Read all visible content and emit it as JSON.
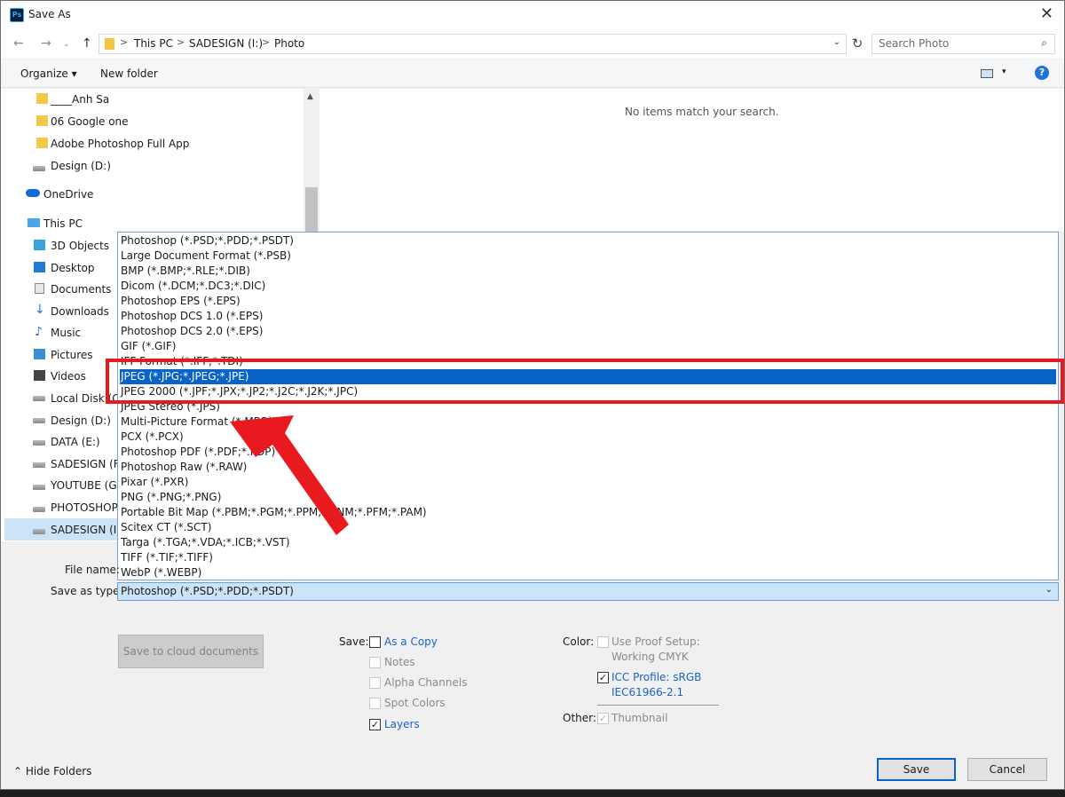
{
  "window": {
    "title": "Save As",
    "app_icon": "Ps"
  },
  "address": {
    "crumbs": [
      "This PC",
      "SADESIGN (I:)",
      "Photo"
    ],
    "search_placeholder": "Search Photo"
  },
  "toolbar": {
    "organize": "Organize",
    "new_folder": "New folder",
    "help": "?"
  },
  "content": {
    "empty_message": "No items match your search."
  },
  "nav": {
    "items": [
      "____Anh Sa",
      "06 Google one",
      "Adobe Photoshop Full App",
      "Design (D:)",
      "OneDrive",
      "This PC",
      "3D Objects",
      "Desktop",
      "Documents",
      "Downloads",
      "Music",
      "Pictures",
      "Videos",
      "Local Disk (C:)",
      "Design (D:)",
      "DATA  (E:)",
      "SADESIGN (F:)",
      "YOUTUBE (G:)",
      "PHOTOSHOP",
      "SADESIGN (I:)"
    ]
  },
  "filetypes": {
    "options": [
      "Photoshop (*.PSD;*.PDD;*.PSDT)",
      "Large Document Format (*.PSB)",
      "BMP (*.BMP;*.RLE;*.DIB)",
      "Dicom (*.DCM;*.DC3;*.DIC)",
      "Photoshop EPS (*.EPS)",
      "Photoshop DCS 1.0 (*.EPS)",
      "Photoshop DCS 2.0 (*.EPS)",
      "GIF (*.GIF)",
      "IFF Format (*.IFF;*.TDI)",
      "JPEG (*.JPG;*.JPEG;*.JPE)",
      "JPEG 2000 (*.JPF;*.JPX;*.JP2;*.J2C;*.J2K;*.JPC)",
      "JPEG Stereo (*.JPS)",
      "Multi-Picture Format (*.MPO)",
      "PCX (*.PCX)",
      "Photoshop PDF (*.PDF;*.PDP)",
      "Photoshop Raw (*.RAW)",
      "Pixar (*.PXR)",
      "PNG (*.PNG;*.PNG)",
      "Portable Bit Map (*.PBM;*.PGM;*.PPM;*.PNM;*.PFM;*.PAM)",
      "Scitex CT (*.SCT)",
      "Targa (*.TGA;*.VDA;*.ICB;*.VST)",
      "TIFF (*.TIF;*.TIFF)",
      "WebP (*.WEBP)"
    ],
    "selected_index": 9
  },
  "form": {
    "file_name_label": "File name:",
    "save_type_label": "Save as type:",
    "save_type_value": "Photoshop (*.PSD;*.PDD;*.PSDT)"
  },
  "options": {
    "cloud_button": "Save to cloud documents",
    "save_label": "Save:",
    "as_copy": "As a Copy",
    "notes": "Notes",
    "alpha": "Alpha Channels",
    "spot": "Spot Colors",
    "layers": "Layers",
    "color_label": "Color:",
    "proof_line1": "Use Proof Setup:",
    "proof_line2": "Working CMYK",
    "icc_line1": "ICC Profile:  sRGB",
    "icc_line2": "IEC61966-2.1",
    "other_label": "Other:",
    "thumbnail": "Thumbnail"
  },
  "footer": {
    "hide_folders": "Hide Folders",
    "save": "Save",
    "cancel": "Cancel"
  },
  "colors": {
    "accent": "#0a64c8",
    "highlight": "#e8191f"
  }
}
